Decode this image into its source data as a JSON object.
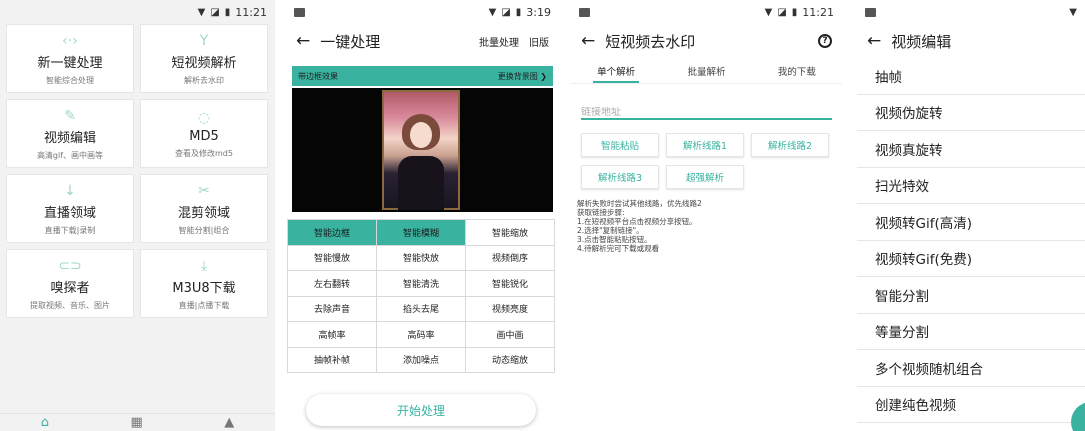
{
  "panel1": {
    "statusbar": {
      "time": "11:21"
    },
    "cards": [
      {
        "icon": "code-arrows-icon",
        "glyph": "‹·›",
        "title": "新一键处理",
        "subtitle": "智能综合处理"
      },
      {
        "icon": "fork-icon",
        "glyph": "Y",
        "title": "短视频解析",
        "subtitle": "解析去水印"
      },
      {
        "icon": "pencil-icon",
        "glyph": "✎",
        "title": "视频编辑",
        "subtitle": "高清gif、画中画等"
      },
      {
        "icon": "dashed-circle-icon",
        "glyph": "◌",
        "title": "MD5",
        "subtitle": "查看及修改md5"
      },
      {
        "icon": "download-arrow-icon",
        "glyph": "↓",
        "title": "直播领域",
        "subtitle": "直播下载|录制"
      },
      {
        "icon": "scissors-icon",
        "glyph": "✂",
        "title": "混剪领域",
        "subtitle": "智能分割|组合"
      },
      {
        "icon": "link-icon",
        "glyph": "⊂⊃",
        "title": "嗅探者",
        "subtitle": "提取视频、音乐、图片"
      },
      {
        "icon": "download-tray-icon",
        "glyph": "⤓",
        "title": "M3U8下载",
        "subtitle": "直播|点播下载"
      }
    ],
    "nav": [
      {
        "icon": "home-icon",
        "glyph": "⌂",
        "active": true
      },
      {
        "icon": "grid-icon",
        "glyph": "▦",
        "active": false
      },
      {
        "icon": "bell-icon",
        "glyph": "▲",
        "active": false
      }
    ]
  },
  "panel2": {
    "statusbar": {
      "time": "3:19"
    },
    "title": "一键处理",
    "actions": [
      "批量处理",
      "旧版"
    ],
    "banner": {
      "left": "带边框效果",
      "right": "更换背景图 ❯"
    },
    "buttons": [
      {
        "label": "智能边框",
        "active": true
      },
      {
        "label": "智能模糊",
        "active": true
      },
      {
        "label": "智能缩放",
        "active": false
      },
      {
        "label": "智能慢放",
        "active": false
      },
      {
        "label": "智能快放",
        "active": false
      },
      {
        "label": "视频倒序",
        "active": false
      },
      {
        "label": "左右翻转",
        "active": false
      },
      {
        "label": "智能清洗",
        "active": false
      },
      {
        "label": "智能锐化",
        "active": false
      },
      {
        "label": "去除声音",
        "active": false
      },
      {
        "label": "掐头去尾",
        "active": false
      },
      {
        "label": "视频亮度",
        "active": false
      },
      {
        "label": "高帧率",
        "active": false
      },
      {
        "label": "高码率",
        "active": false
      },
      {
        "label": "画中画",
        "active": false
      },
      {
        "label": "抽帧补帧",
        "active": false
      },
      {
        "label": "添加噪点",
        "active": false
      },
      {
        "label": "动态缩放",
        "active": false
      }
    ],
    "start_label": "开始处理"
  },
  "panel3": {
    "statusbar": {
      "time": "11:21"
    },
    "title": "短视频去水印",
    "tabs": [
      "单个解析",
      "批量解析",
      "我的下载"
    ],
    "input_placeholder": "链接地址",
    "chips": [
      "智能粘贴",
      "解析线路1",
      "解析线路2",
      "解析线路3",
      "超强解析"
    ],
    "hint_lines": [
      "解析失败时尝试其他线路，优先线路2",
      "获取链接步骤:",
      "1.在短视频平台点击视频分享按钮。",
      "2.选择\"复制链接\"。",
      "3.点击智能粘贴按钮。",
      "4.待解析完可下载或观看"
    ]
  },
  "panel4": {
    "title": "视频编辑",
    "items": [
      "抽帧",
      "视频伪旋转",
      "视频真旋转",
      "扫光特效",
      "视频转Gif(高清)",
      "视频转Gif(免费)",
      "智能分割",
      "等量分割",
      "多个视频随机组合",
      "创建纯色视频"
    ]
  },
  "colors": {
    "accent": "#39b3a0"
  }
}
